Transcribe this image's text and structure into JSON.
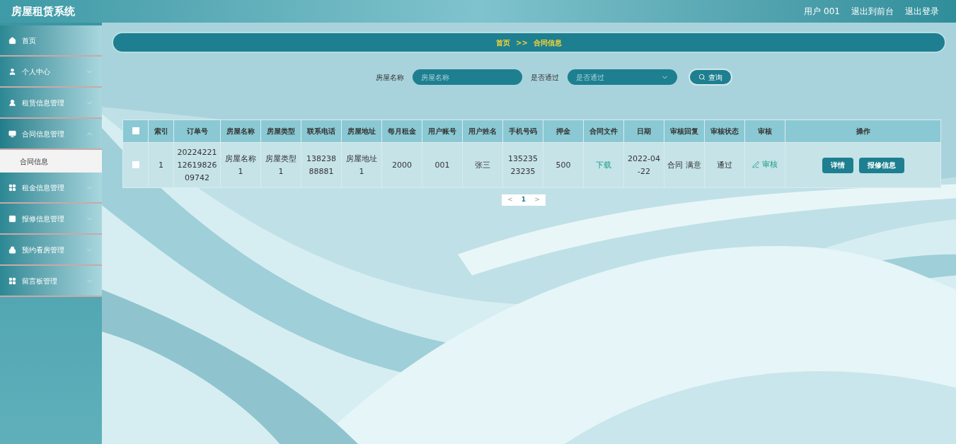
{
  "header": {
    "title": "房屋租赁系统",
    "links": [
      "用户 001",
      "退出到前台",
      "退出登录"
    ]
  },
  "sidebar": {
    "items": [
      {
        "label": "首页"
      },
      {
        "label": "个人中心",
        "expanded": false
      },
      {
        "label": "租赁信息管理",
        "expanded": false
      },
      {
        "label": "合同信息管理",
        "expanded": true,
        "children": [
          {
            "label": "合同信息",
            "selected": true
          }
        ]
      },
      {
        "label": "租金信息管理",
        "expanded": false
      },
      {
        "label": "报修信息管理",
        "expanded": false
      },
      {
        "label": "预约看房管理",
        "expanded": false
      },
      {
        "label": "留言板管理",
        "expanded": false
      }
    ]
  },
  "breadcrumb": [
    "首页",
    ">>",
    "合同信息"
  ],
  "search": {
    "fields": [
      {
        "kind": "input",
        "label": "房屋名称",
        "placeholder": "房屋名称"
      },
      {
        "kind": "select",
        "label": "是否通过",
        "placeholder": "是否通过"
      }
    ],
    "button": "查询"
  },
  "table": {
    "all_checked": false,
    "columns": [
      "索引",
      "订单号",
      "房屋名称",
      "房屋类型",
      "联系电话",
      "房屋地址",
      "每月租金",
      "用户账号",
      "用户姓名",
      "手机号码",
      "押金",
      "合同文件",
      "日期",
      "审核回复",
      "审核状态",
      "审核",
      "操作"
    ],
    "rows": [
      {
        "checked": false,
        "cells": [
          {
            "kind": "text",
            "text": "1"
          },
          {
            "kind": "text",
            "text": "202242211261982609742"
          },
          {
            "kind": "text",
            "text": "房屋名称1"
          },
          {
            "kind": "text",
            "text": "房屋类型1"
          },
          {
            "kind": "text",
            "text": "13823888881"
          },
          {
            "kind": "text",
            "text": "房屋地址1"
          },
          {
            "kind": "text",
            "text": "2000"
          },
          {
            "kind": "text",
            "text": "001"
          },
          {
            "kind": "text",
            "text": "张三"
          },
          {
            "kind": "text",
            "text": "13523523235"
          },
          {
            "kind": "text",
            "text": "500"
          },
          {
            "kind": "link",
            "text": "下载"
          },
          {
            "kind": "text",
            "text": "2022-04-22"
          },
          {
            "kind": "text",
            "text": "合同 满意"
          },
          {
            "kind": "text",
            "text": "通过"
          },
          {
            "kind": "action",
            "text": "审核"
          },
          {
            "kind": "buttons",
            "buttons": [
              "详情",
              "报修信息"
            ]
          }
        ]
      }
    ]
  },
  "pagination": {
    "prev": "<",
    "pages": [
      {
        "label": "1",
        "selected": true
      }
    ],
    "next": ">"
  }
}
